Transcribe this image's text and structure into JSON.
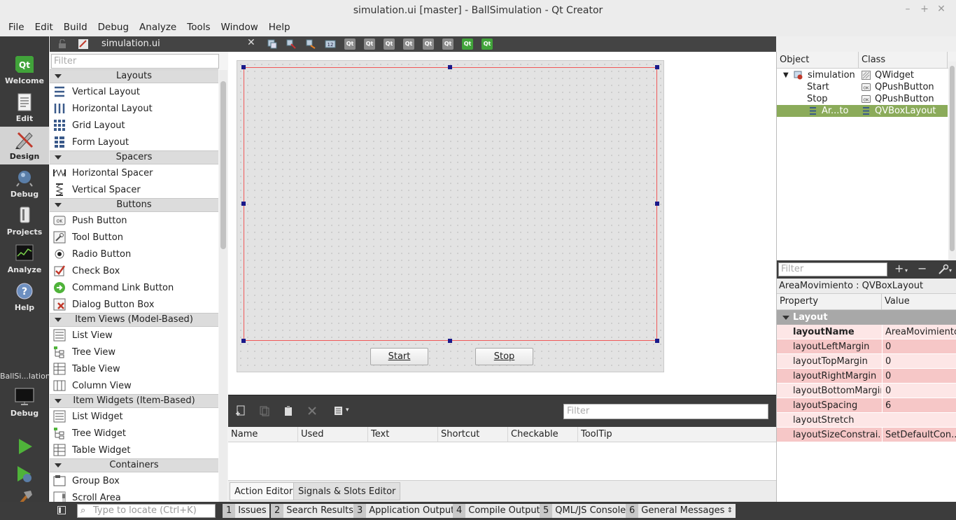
{
  "window": {
    "title": "simulation.ui [master] - BallSimulation - Qt Creator"
  },
  "menu": [
    "File",
    "Edit",
    "Build",
    "Debug",
    "Analyze",
    "Tools",
    "Window",
    "Help"
  ],
  "modes": [
    "Welcome",
    "Edit",
    "Design",
    "Debug",
    "Projects",
    "Analyze",
    "Help"
  ],
  "kit": {
    "project": "BallSi...lation",
    "config": "Debug"
  },
  "editor": {
    "filename": "simulation.ui"
  },
  "widgetbox": {
    "filter_placeholder": "Filter",
    "categories": [
      {
        "name": "Layouts",
        "items": [
          "Vertical Layout",
          "Horizontal Layout",
          "Grid Layout",
          "Form Layout"
        ]
      },
      {
        "name": "Spacers",
        "items": [
          "Horizontal Spacer",
          "Vertical Spacer"
        ]
      },
      {
        "name": "Buttons",
        "items": [
          "Push Button",
          "Tool Button",
          "Radio Button",
          "Check Box",
          "Command Link Button",
          "Dialog Button Box"
        ]
      },
      {
        "name": "Item Views (Model-Based)",
        "items": [
          "List View",
          "Tree View",
          "Table View",
          "Column View"
        ]
      },
      {
        "name": "Item Widgets (Item-Based)",
        "items": [
          "List Widget",
          "Tree Widget",
          "Table Widget"
        ]
      },
      {
        "name": "Containers",
        "items": [
          "Group Box",
          "Scroll Area"
        ]
      }
    ]
  },
  "form": {
    "start_label": "Start",
    "stop_label": "Stop"
  },
  "action_editor": {
    "filter_placeholder": "Filter",
    "columns": [
      "Name",
      "Used",
      "Text",
      "Shortcut",
      "Checkable",
      "ToolTip"
    ],
    "tabs": [
      "Action Editor",
      "Signals & Slots Editor"
    ]
  },
  "object_inspector": {
    "headers": [
      "Object",
      "Class"
    ],
    "rows": [
      {
        "object": "simulation",
        "class": "QWidget"
      },
      {
        "object": "Start",
        "class": "QPushButton"
      },
      {
        "object": "Stop",
        "class": "QPushButton"
      },
      {
        "object": "Ar...to",
        "class": "QVBoxLayout"
      }
    ]
  },
  "property_editor": {
    "filter_placeholder": "Filter",
    "title": "AreaMovimiento : QVBoxLayout",
    "headers": [
      "Property",
      "Value"
    ],
    "group": "Layout",
    "rows": [
      {
        "name": "layoutName",
        "value": "AreaMovimiento"
      },
      {
        "name": "layoutLeftMargin",
        "value": "0"
      },
      {
        "name": "layoutTopMargin",
        "value": "0"
      },
      {
        "name": "layoutRightMargin",
        "value": "0"
      },
      {
        "name": "layoutBottomMargin",
        "value": "0"
      },
      {
        "name": "layoutSpacing",
        "value": "6"
      },
      {
        "name": "layoutStretch",
        "value": ""
      },
      {
        "name": "layoutSizeConstrai...",
        "value": "SetDefaultCon..."
      }
    ]
  },
  "statusbar": {
    "locator_placeholder": "Type to locate (Ctrl+K)",
    "panes": [
      {
        "num": "1",
        "label": "Issues"
      },
      {
        "num": "2",
        "label": "Search Results"
      },
      {
        "num": "3",
        "label": "Application Output"
      },
      {
        "num": "4",
        "label": "Compile Output"
      },
      {
        "num": "5",
        "label": "QML/JS Console"
      },
      {
        "num": "6",
        "label": "General Messages"
      }
    ]
  },
  "toolbar_icons": [
    "Qt",
    "Qt",
    "Qt",
    "Qt",
    "Qt",
    "Qt",
    "Qt",
    "Qt"
  ],
  "colors": {
    "selection": "#8bab5a",
    "changed_property": "#f6c7c7",
    "layout_border": "#f05858",
    "modebar": "#3b3b3b"
  }
}
